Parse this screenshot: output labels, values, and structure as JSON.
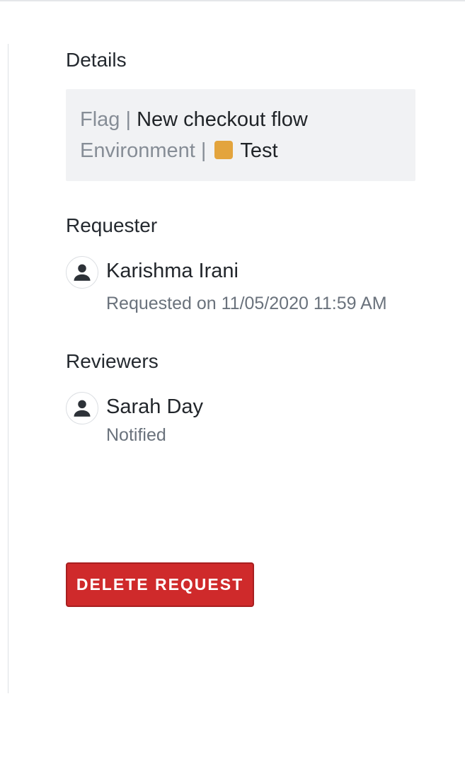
{
  "details": {
    "title": "Details",
    "flag_label": "Flag |",
    "flag_value": "New checkout flow",
    "environment_label": "Environment |",
    "environment_value": "Test",
    "environment_color": "#e3a43d"
  },
  "requester": {
    "title": "Requester",
    "name": "Karishma Irani",
    "subtitle": "Requested on 11/05/2020 11:59 AM",
    "icon": "person-icon"
  },
  "reviewers": {
    "title": "Reviewers",
    "items": [
      {
        "name": "Sarah Day",
        "status": "Notified",
        "icon": "person-icon"
      }
    ]
  },
  "actions": {
    "delete_label": "DELETE REQUEST",
    "delete_color": "#cf2a2b"
  }
}
